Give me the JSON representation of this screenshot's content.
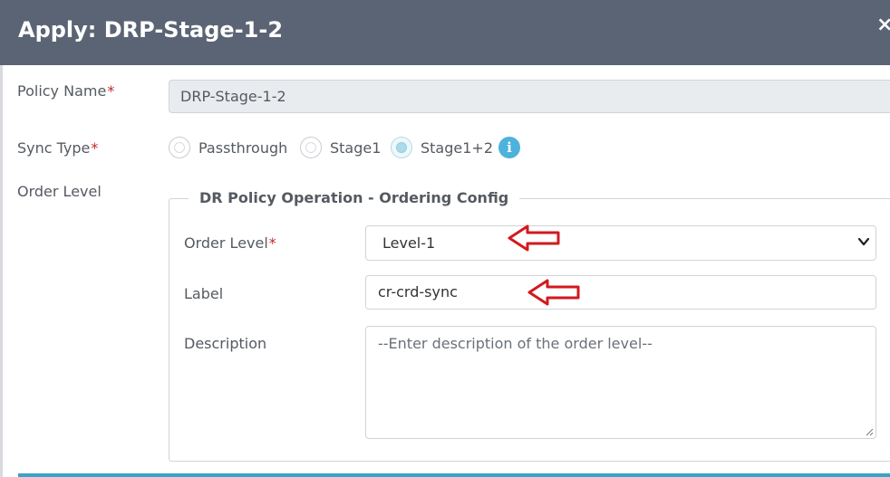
{
  "dialog": {
    "title": "Apply: DRP-Stage-1-2",
    "close_icon": "×"
  },
  "policy_name": {
    "label": "Policy Name",
    "required": "*",
    "value": "DRP-Stage-1-2"
  },
  "sync_type": {
    "label": "Sync Type",
    "required": "*",
    "options": [
      {
        "label": "Passthrough",
        "checked": false
      },
      {
        "label": "Stage1",
        "checked": false
      },
      {
        "label": "Stage1+2",
        "checked": true
      }
    ],
    "info_icon": "i"
  },
  "order_level_section": {
    "label": "Order Level",
    "legend": "DR Policy Operation - Ordering Config",
    "order_level": {
      "label": "Order Level",
      "required": "*",
      "selected": "Level-1"
    },
    "label_field": {
      "label": "Label",
      "value": "cr-crd-sync"
    },
    "description": {
      "label": "Description",
      "placeholder": "--Enter description of the order level--"
    }
  },
  "colors": {
    "header_bg": "#5b6474",
    "arrow": "#d2191f",
    "accent": "#38a3c8",
    "info": "#4db2dc",
    "required": "#c0272d"
  },
  "icons": [
    "close-icon",
    "info-icon",
    "chevron-down-icon",
    "resize-handle-icon",
    "red-arrow-annotation"
  ]
}
